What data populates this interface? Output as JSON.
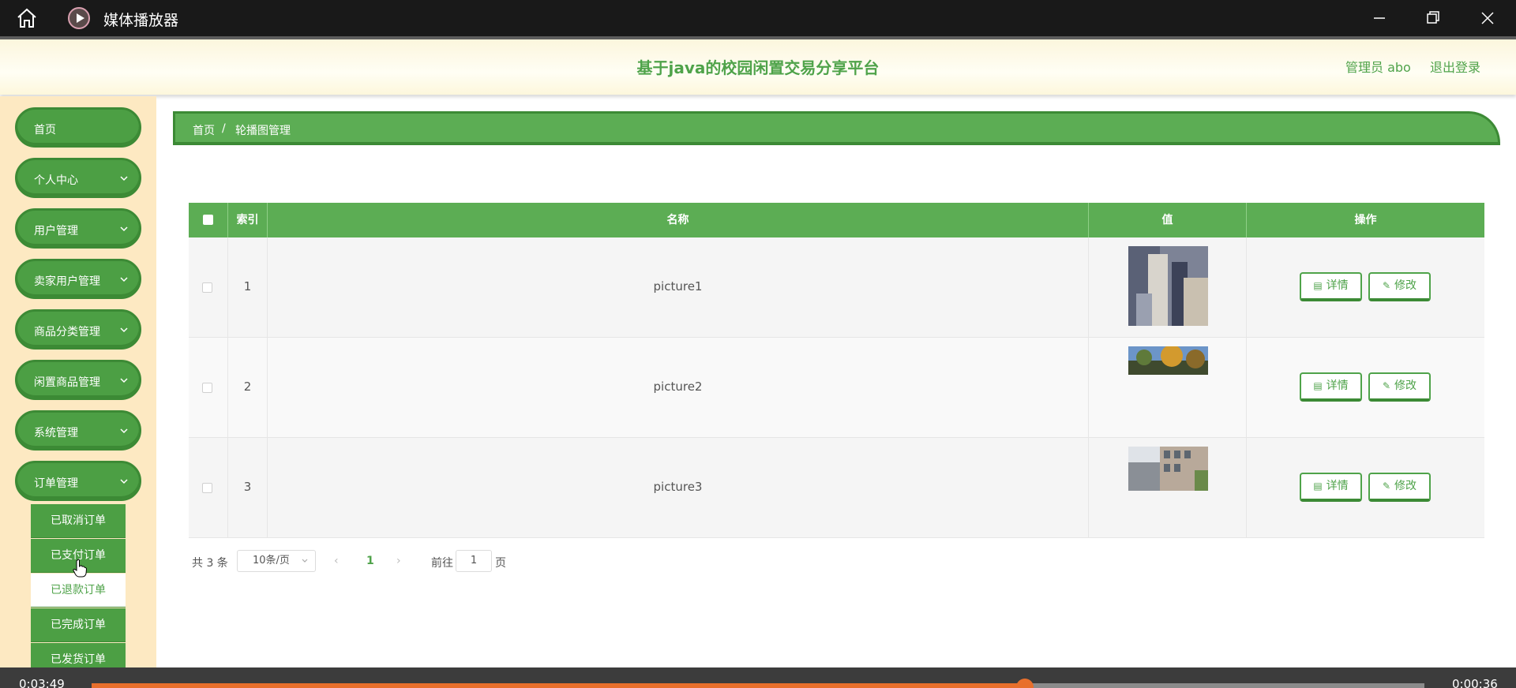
{
  "player": {
    "title": "媒体播放器",
    "current_time": "0:03:49",
    "duration": "0:00:36",
    "progress": 0.7
  },
  "header": {
    "site_title": "基于java的校园闲置交易分享平台",
    "admin": "管理员 abo",
    "logout": "退出登录"
  },
  "sidebar": {
    "items": [
      {
        "label": "首页"
      },
      {
        "label": "个人中心"
      },
      {
        "label": "用户管理"
      },
      {
        "label": "卖家用户管理"
      },
      {
        "label": "商品分类管理"
      },
      {
        "label": "闲置商品管理"
      },
      {
        "label": "系统管理"
      },
      {
        "label": "订单管理"
      }
    ],
    "submenu": [
      {
        "label": "已取消订单"
      },
      {
        "label": "已支付订单"
      },
      {
        "label": "已退款订单"
      },
      {
        "label": "已完成订单"
      },
      {
        "label": "已发货订单"
      }
    ]
  },
  "breadcrumb": {
    "home": "首页",
    "separator": "/",
    "current": "轮播图管理"
  },
  "table": {
    "headers": {
      "index": "索引",
      "name": "名称",
      "value": "值",
      "actions": "操作"
    },
    "rows": [
      {
        "index": "1",
        "name": "picture1"
      },
      {
        "index": "2",
        "name": "picture2"
      },
      {
        "index": "3",
        "name": "picture3"
      }
    ],
    "detail_label": "详情",
    "edit_label": "修改"
  },
  "pager": {
    "total": "共 3 条",
    "page_size": "10条/页",
    "current_page": "1",
    "goto_label": "前往",
    "goto_value": "1",
    "page_suffix": "页"
  },
  "colors": {
    "primary": "#4fa34a",
    "sidebar_bg": "#fde9c2",
    "progress": "#e86f2c"
  }
}
